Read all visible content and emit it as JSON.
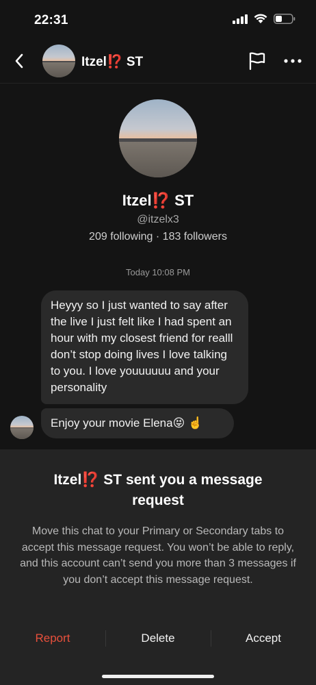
{
  "status_bar": {
    "time": "22:31"
  },
  "header": {
    "name": "Itzel⁉️ ST"
  },
  "profile": {
    "name": "Itzel⁉️ ST",
    "handle": "@itzelx3",
    "stats": "209 following · 183 followers"
  },
  "chat": {
    "timestamp": "Today 10:08 PM",
    "messages": [
      {
        "text": "Heyyy so I just wanted to say after the live I just felt like I had spent an hour with my closest friend for realll don’t stop doing lives I love talking to you. I love youuuuuu and your personality"
      },
      {
        "text": "Enjoy your movie Elena😝 ☝️"
      }
    ]
  },
  "request_sheet": {
    "title": "Itzel⁉️ ST sent you a message request",
    "body": "Move this chat to your Primary or Secondary tabs to accept this message request. You won’t be able to reply, and this account can’t send you more than 3 messages if you don’t accept this message request.",
    "actions": {
      "report": "Report",
      "delete": "Delete",
      "accept": "Accept"
    }
  },
  "colors": {
    "background": "#141414",
    "bubble": "#2a2a2a",
    "sheet": "#242424",
    "report": "#e8503c"
  }
}
